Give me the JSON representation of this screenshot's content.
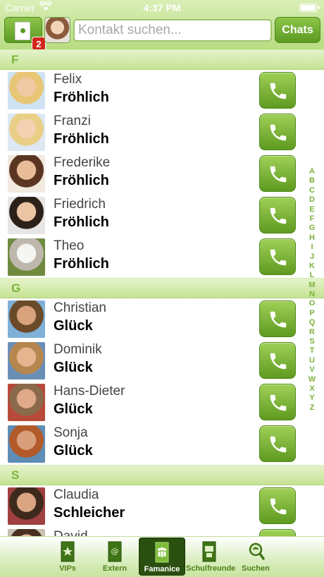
{
  "status_bar": {
    "carrier": "Carrier",
    "time": "4:37 PM",
    "battery_level": 1.0
  },
  "header": {
    "badge_count": "2",
    "search": {
      "placeholder": "Kontakt suchen...",
      "value": ""
    },
    "chats_label": "Chats"
  },
  "sections": [
    {
      "letter": "F",
      "contacts": [
        {
          "first": "Felix",
          "last": "Fröhlich"
        },
        {
          "first": "Franzi",
          "last": "Fröhlich"
        },
        {
          "first": "Frederike",
          "last": "Fröhlich"
        },
        {
          "first": "Friedrich",
          "last": "Fröhlich"
        },
        {
          "first": "Theo",
          "last": "Fröhlich"
        }
      ]
    },
    {
      "letter": "G",
      "contacts": [
        {
          "first": "Christian",
          "last": "Glück"
        },
        {
          "first": "Dominik",
          "last": "Glück"
        },
        {
          "first": "Hans-Dieter",
          "last": "Glück"
        },
        {
          "first": "Sonja",
          "last": "Glück"
        }
      ]
    },
    {
      "letter": "S",
      "contacts": [
        {
          "first": "Claudia",
          "last": "Schleicher"
        },
        {
          "first": "David",
          "last": ""
        }
      ]
    }
  ],
  "index_letters": [
    "A",
    "B",
    "C",
    "D",
    "E",
    "F",
    "G",
    "H",
    "I",
    "J",
    "K",
    "L",
    "M",
    "N",
    "O",
    "P",
    "Q",
    "R",
    "S",
    "T",
    "U",
    "V",
    "W",
    "X",
    "Y",
    "Z"
  ],
  "tabs": [
    {
      "label": "VIPs",
      "icon": "vip-door-icon",
      "active": false
    },
    {
      "label": "Extern",
      "icon": "extern-door-icon",
      "active": false
    },
    {
      "label": "Famanice",
      "icon": "family-door-icon",
      "active": true
    },
    {
      "label": "Schulfreunde",
      "icon": "school-door-icon",
      "active": false
    },
    {
      "label": "Suchen",
      "icon": "search-icon",
      "active": false
    }
  ],
  "colors": {
    "accent": "#7bb33b",
    "button_green": "#5f9a21",
    "active_tab": "#2a4f10",
    "badge": "#d0261c"
  }
}
